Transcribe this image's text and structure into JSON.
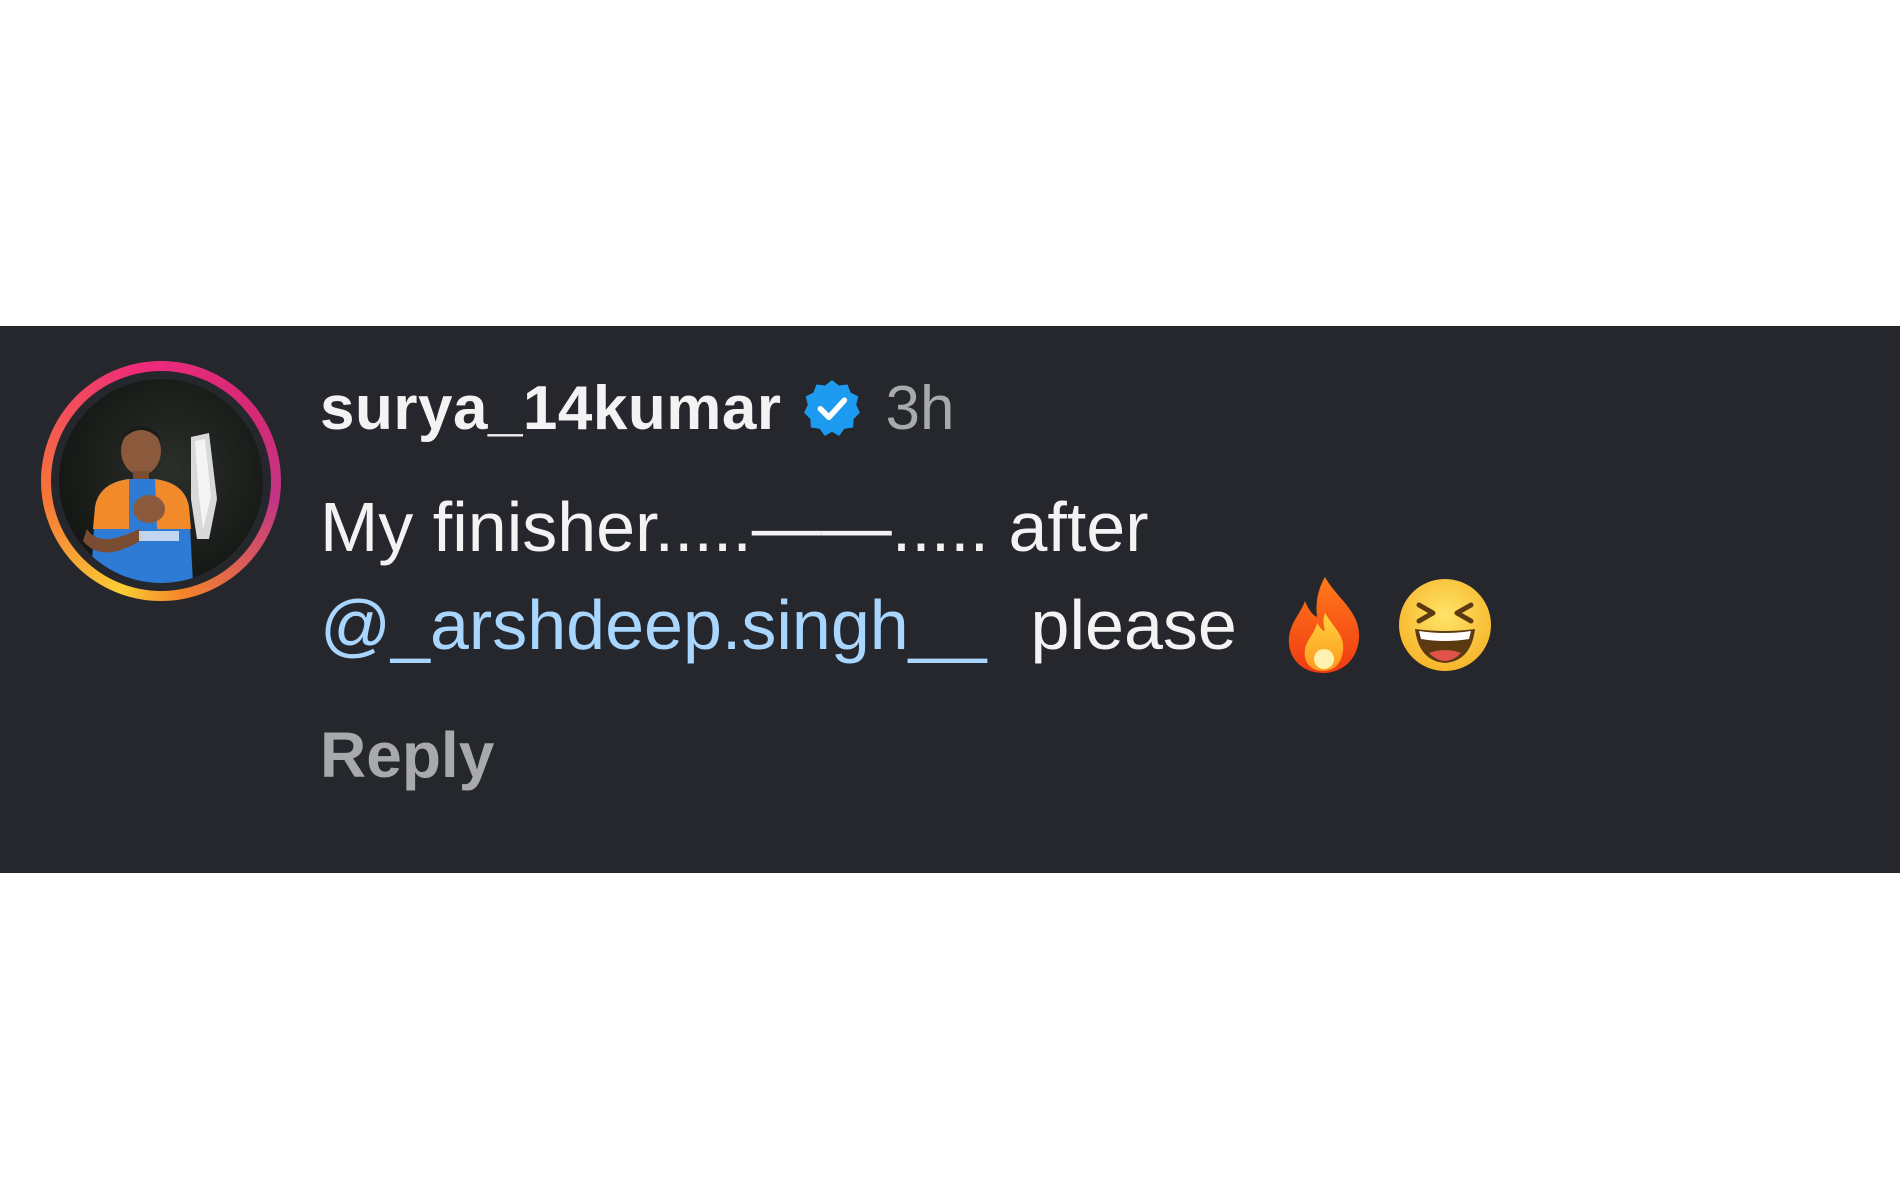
{
  "comment": {
    "username": "surya_14kumar",
    "timestamp": "3h",
    "verified": true,
    "text_line1": "My finisher.....——..... after",
    "mention": "@_arshdeep.singh__",
    "text_after_mention": "please",
    "emojis": [
      "fire",
      "grinning-squinting-face"
    ],
    "reply_label": "Reply"
  },
  "colors": {
    "band_background": "#25272c",
    "username": "#f3f3f3",
    "secondary": "#a8a9ad",
    "mention": "#a9d6ff",
    "verified_badge": "#1d9bf0"
  }
}
